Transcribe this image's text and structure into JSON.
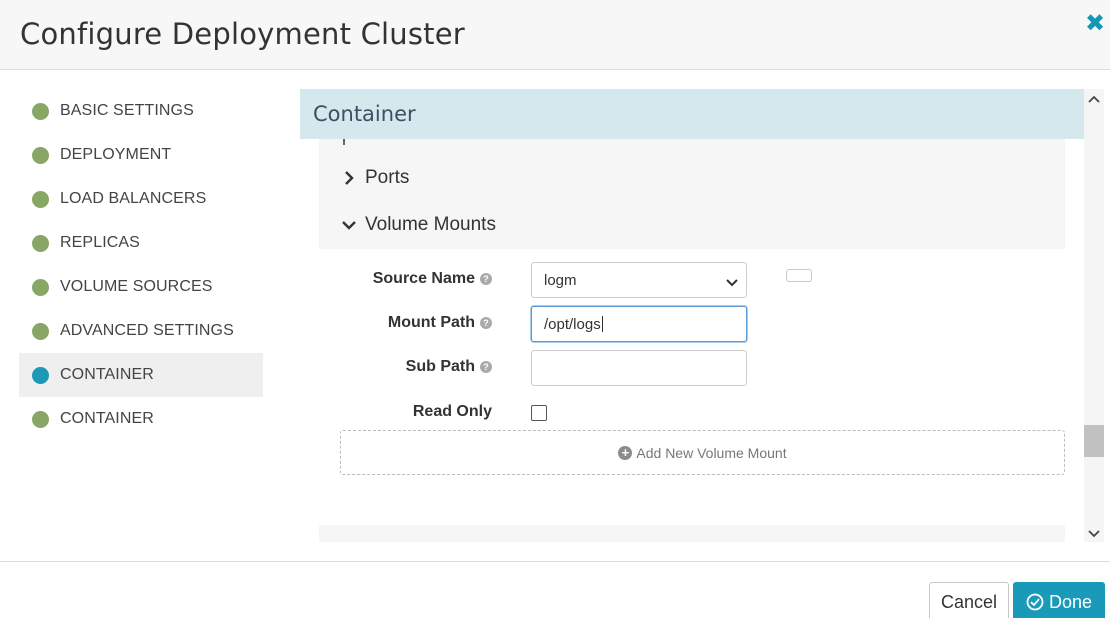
{
  "dialog": {
    "title": "Configure Deployment Cluster",
    "close_glyph": "✖"
  },
  "sidebar": {
    "items": [
      {
        "label": "BASIC SETTINGS",
        "active": false
      },
      {
        "label": "DEPLOYMENT",
        "active": false
      },
      {
        "label": "LOAD BALANCERS",
        "active": false
      },
      {
        "label": "REPLICAS",
        "active": false
      },
      {
        "label": "VOLUME SOURCES",
        "active": false
      },
      {
        "label": "ADVANCED SETTINGS",
        "active": false
      },
      {
        "label": "CONTAINER",
        "active": true
      },
      {
        "label": "CONTAINER",
        "active": false
      }
    ]
  },
  "section": {
    "title": "Container",
    "expanders": [
      {
        "label": "Ports",
        "expanded": false
      },
      {
        "label": "Volume Mounts",
        "expanded": true
      }
    ]
  },
  "form": {
    "source_name": {
      "label": "Source Name",
      "value": "logm"
    },
    "mount_path": {
      "label": "Mount Path",
      "value": "/opt/logs"
    },
    "sub_path": {
      "label": "Sub Path",
      "value": ""
    },
    "read_only": {
      "label": "Read Only",
      "checked": false
    },
    "help_glyph": "?",
    "add_label": "Add New Volume Mount",
    "add_glyph": "+"
  },
  "footer": {
    "cancel_label": "Cancel",
    "done_label": "Done"
  },
  "colors": {
    "accent": "#1a9ab9",
    "completed_dot": "#88a765",
    "active_dot": "#1f98b7",
    "section_header_bg": "#d4e8ee"
  },
  "icons": {
    "close": "close-icon",
    "collapsed": "chevron-right-icon",
    "expanded": "chevron-down-icon",
    "select": "chevron-down-icon",
    "help": "question-circle-icon",
    "add": "plus-circle-icon",
    "done": "check-circle-icon"
  }
}
